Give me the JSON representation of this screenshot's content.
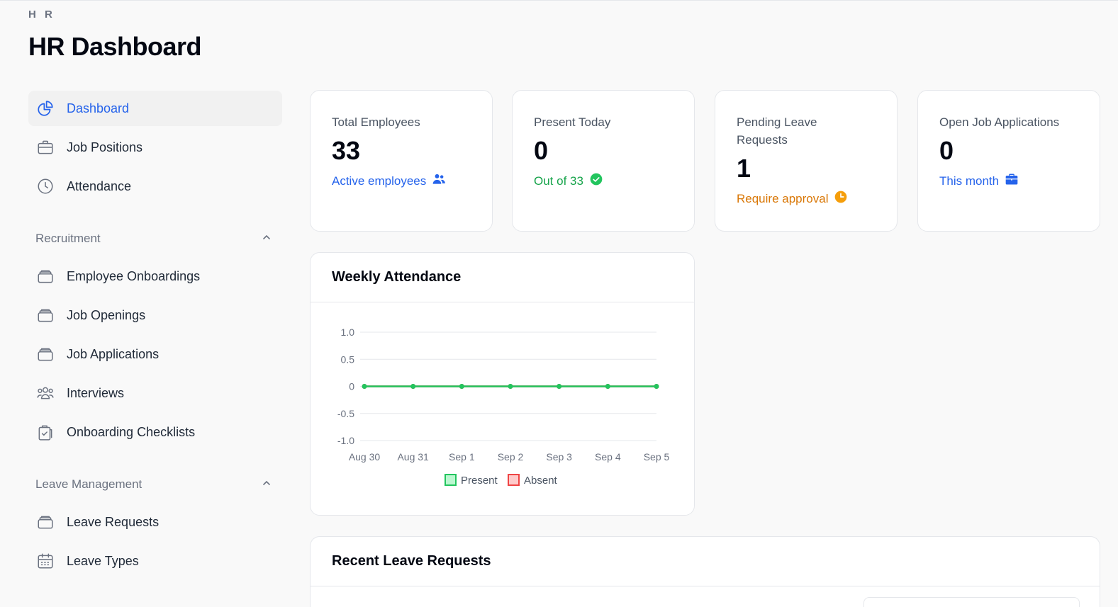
{
  "header": {
    "brand": "H R",
    "title": "HR Dashboard"
  },
  "sidebar": {
    "top_items": [
      {
        "label": "Dashboard",
        "icon": "pie-chart-icon",
        "active": true
      },
      {
        "label": "Job Positions",
        "icon": "briefcase-icon"
      },
      {
        "label": "Attendance",
        "icon": "clock-icon"
      }
    ],
    "groups": [
      {
        "label": "Recruitment",
        "items": [
          {
            "label": "Employee Onboardings",
            "icon": "stack-icon"
          },
          {
            "label": "Job Openings",
            "icon": "stack-icon"
          },
          {
            "label": "Job Applications",
            "icon": "stack-icon"
          },
          {
            "label": "Interviews",
            "icon": "users-icon"
          },
          {
            "label": "Onboarding Checklists",
            "icon": "clipboard-check-icon"
          }
        ]
      },
      {
        "label": "Leave Management",
        "items": [
          {
            "label": "Leave Requests",
            "icon": "stack-icon"
          },
          {
            "label": "Leave Types",
            "icon": "calendar-icon"
          }
        ]
      }
    ]
  },
  "stats": [
    {
      "label": "Total Employees",
      "value": "33",
      "note": "Active employees",
      "note_color": "#2563eb",
      "icon": "users-icon"
    },
    {
      "label": "Present Today",
      "value": "0",
      "note": "Out of 33",
      "note_color": "#16a34a",
      "icon": "check-circle-icon"
    },
    {
      "label": "Pending Leave Requests",
      "value": "1",
      "note": "Require approval",
      "note_color": "#d97706",
      "icon": "clock-icon"
    },
    {
      "label": "Open Job Applications",
      "value": "0",
      "note": "This month",
      "note_color": "#2563eb",
      "icon": "briefcase-icon"
    }
  ],
  "weekly_attendance": {
    "title": "Weekly Attendance"
  },
  "recent_leave": {
    "title": "Recent Leave Requests"
  },
  "chart_data": {
    "type": "line",
    "title": "Weekly Attendance",
    "categories": [
      "Aug 30",
      "Aug 31",
      "Sep 1",
      "Sep 2",
      "Sep 3",
      "Sep 4",
      "Sep 5"
    ],
    "series": [
      {
        "name": "Present",
        "values": [
          0,
          0,
          0,
          0,
          0,
          0,
          0
        ],
        "color": "#22c55e"
      },
      {
        "name": "Absent",
        "values": [
          0,
          0,
          0,
          0,
          0,
          0,
          0
        ],
        "color": "#ef4444"
      }
    ],
    "yticks": [
      "1.0",
      "0.5",
      "0",
      "-0.5",
      "-1.0"
    ],
    "ylim": [
      -1,
      1
    ],
    "grid": true,
    "legend": "bottom"
  }
}
